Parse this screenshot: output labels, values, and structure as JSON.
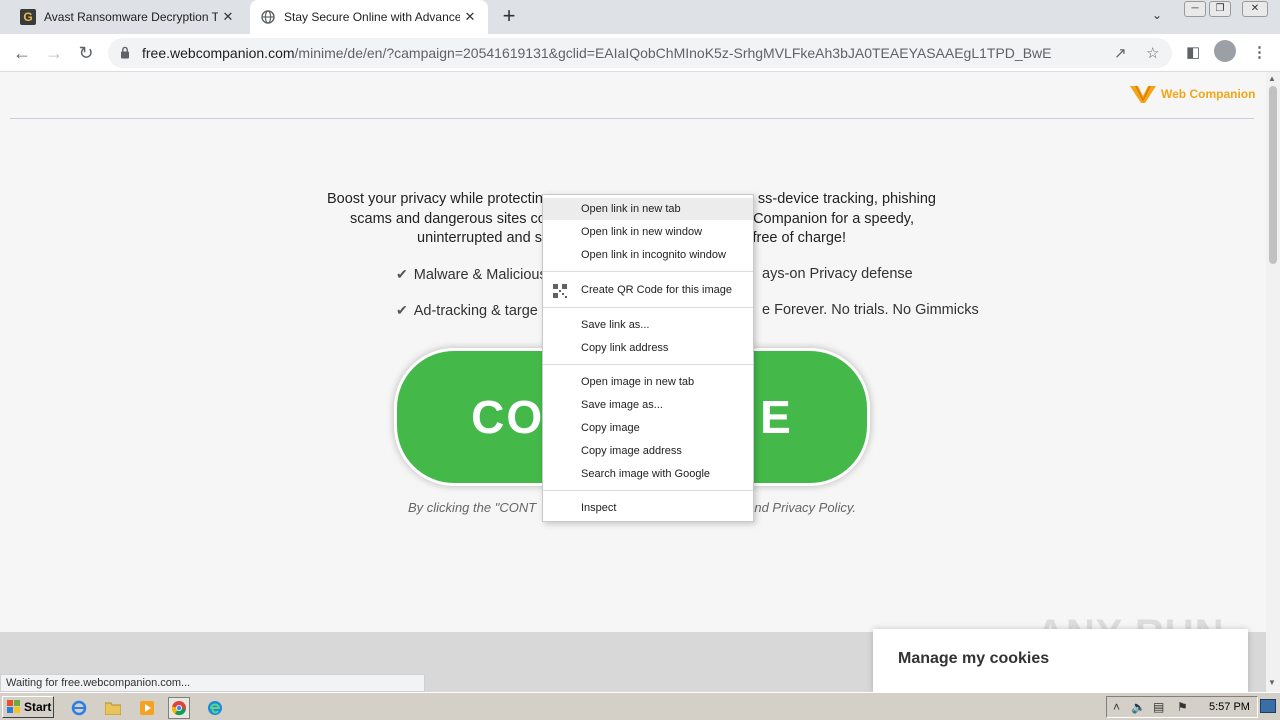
{
  "browser": {
    "tabs": [
      {
        "title": "Avast Ransomware Decryption Tools",
        "active": false
      },
      {
        "title": "Stay Secure Online with Advanced A",
        "active": true
      }
    ],
    "new_tab_label": "+",
    "close_glyph": "✕",
    "url": {
      "host": "free.webcompanion.com",
      "path": "/minime/de/en/?campaign=20541619131&gclid=EAIaIQobChMInoK5z-SrhgMVLFkeAh3bJA0TEAEYASAAEgL1TPD_BwE"
    }
  },
  "page": {
    "brand": "Web Companion",
    "lead_text": "Boost your privacy while protecting                                                ss-device tracking, phishing scams and dangerous sites co                                                 Companion for a speedy, uninterrupted and s                                                free of charge!",
    "lead_lines": [
      {
        "left": "Boost your privacy while protecting",
        "right": "ss-device tracking, phishing"
      },
      {
        "left": "scams and dangerous sites co",
        "right": "Companion for a speedy,"
      },
      {
        "left": "uninterrupted and s",
        "right": "free of charge!"
      }
    ],
    "features": [
      {
        "left": "Malware & Malicious",
        "right": "ays-on Privacy defense"
      },
      {
        "left": "Ad-tracking & targe",
        "right": "e Forever. No trials. No Gimmicks"
      }
    ],
    "cta_left": "CO",
    "cta_right": "E",
    "disclaimer_left": "By clicking the \"CONT",
    "disclaimer_right": "nd Privacy Policy.",
    "cookies_label": "Manage my cookies",
    "status_text": "Waiting for free.webcompanion.com...",
    "watermark": "ANY RUN"
  },
  "context_menu": {
    "items": [
      "Open link in new tab",
      "Open link in new window",
      "Open link in incognito window",
      "Create QR Code for this image",
      "Save link as...",
      "Copy link address",
      "Open image in new tab",
      "Save image as...",
      "Copy image",
      "Copy image address",
      "Search image with Google",
      "Inspect"
    ],
    "hovered": "Open link in new tab"
  },
  "taskbar": {
    "start_label": "Start",
    "clock": "5:57 PM"
  },
  "colors": {
    "cta_green": "#44b94a",
    "brand_orange": "#f2a516"
  }
}
